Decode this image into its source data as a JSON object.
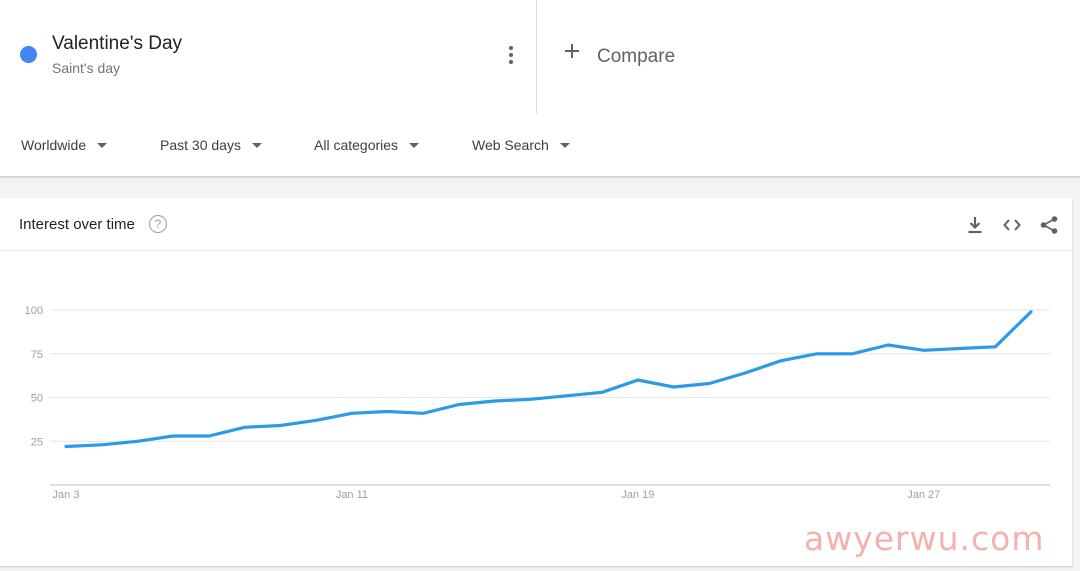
{
  "term": {
    "name": "Valentine's Day",
    "type": "Saint's day",
    "color": "#4285f4"
  },
  "compare": {
    "label": "Compare",
    "icon": "plus-icon"
  },
  "filters": {
    "region": "Worldwide",
    "period": "Past 30 days",
    "category": "All categories",
    "search_type": "Web Search"
  },
  "panel": {
    "title": "Interest over time",
    "help_icon": "?",
    "icons": [
      "download-icon",
      "embed-code-icon",
      "share-icon"
    ]
  },
  "chart_data": {
    "type": "line",
    "title": "",
    "xlabel": "",
    "ylabel": "",
    "ylim": [
      0,
      100
    ],
    "yticks": [
      25,
      50,
      75,
      100
    ],
    "grid": true,
    "x_tick_labels": [
      {
        "index": 0,
        "label": "Jan 3"
      },
      {
        "index": 8,
        "label": "Jan 11"
      },
      {
        "index": 16,
        "label": "Jan 19"
      },
      {
        "index": 24,
        "label": "Jan 27"
      }
    ],
    "series": [
      {
        "color": "#2d9ae8",
        "values": [
          22,
          23,
          25,
          28,
          28,
          33,
          34,
          37,
          41,
          42,
          41,
          46,
          48,
          49,
          51,
          53,
          60,
          56,
          58,
          64,
          71,
          75,
          75,
          80,
          77,
          78,
          79,
          99
        ]
      }
    ]
  },
  "watermark": "awyerwu.com"
}
